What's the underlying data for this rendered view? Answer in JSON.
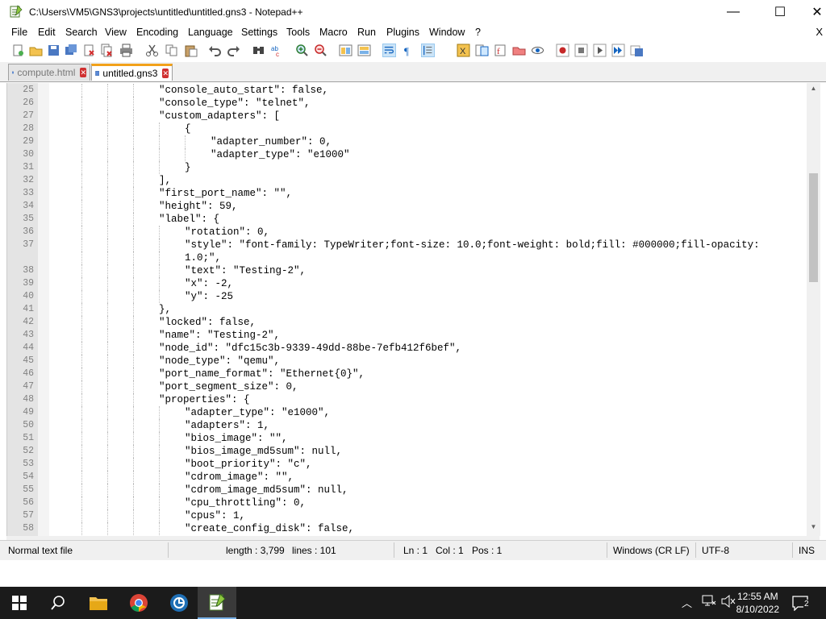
{
  "window": {
    "title": "C:\\Users\\VM5\\GNS3\\projects\\untitled\\untitled.gns3 - Notepad++",
    "minimize": "—",
    "maximize": "☐",
    "close": "✕"
  },
  "menu": {
    "items": [
      "File",
      "Edit",
      "Search",
      "View",
      "Encoding",
      "Language",
      "Settings",
      "Tools",
      "Macro",
      "Run",
      "Plugins",
      "Window",
      "?"
    ],
    "close_x": "X"
  },
  "tabs": [
    {
      "label": "compute.html",
      "active": false
    },
    {
      "label": "untitled.gns3",
      "active": true
    }
  ],
  "editor": {
    "lines": [
      {
        "n": "25",
        "indent": 4,
        "text": "\"console_auto_start\": false,"
      },
      {
        "n": "26",
        "indent": 4,
        "text": "\"console_type\": \"telnet\","
      },
      {
        "n": "27",
        "indent": 4,
        "text": "\"custom_adapters\": ["
      },
      {
        "n": "28",
        "indent": 5,
        "text": "{"
      },
      {
        "n": "29",
        "indent": 6,
        "text": "\"adapter_number\": 0,"
      },
      {
        "n": "30",
        "indent": 6,
        "text": "\"adapter_type\": \"e1000\""
      },
      {
        "n": "31",
        "indent": 5,
        "text": "}"
      },
      {
        "n": "32",
        "indent": 4,
        "text": "],"
      },
      {
        "n": "33",
        "indent": 4,
        "text": "\"first_port_name\": \"\","
      },
      {
        "n": "34",
        "indent": 4,
        "text": "\"height\": 59,"
      },
      {
        "n": "35",
        "indent": 4,
        "text": "\"label\": {"
      },
      {
        "n": "36",
        "indent": 5,
        "text": "\"rotation\": 0,"
      },
      {
        "n": "37",
        "indent": 5,
        "text": "\"style\": \"font-family: TypeWriter;font-size: 10.0;font-weight: bold;fill: #000000;fill-opacity:"
      },
      {
        "n": "",
        "indent": 5,
        "text": "1.0;\","
      },
      {
        "n": "38",
        "indent": 5,
        "text": "\"text\": \"Testing-2\","
      },
      {
        "n": "39",
        "indent": 5,
        "text": "\"x\": -2,"
      },
      {
        "n": "40",
        "indent": 5,
        "text": "\"y\": -25"
      },
      {
        "n": "41",
        "indent": 4,
        "text": "},"
      },
      {
        "n": "42",
        "indent": 4,
        "text": "\"locked\": false,"
      },
      {
        "n": "43",
        "indent": 4,
        "text": "\"name\": \"Testing-2\","
      },
      {
        "n": "44",
        "indent": 4,
        "text": "\"node_id\": \"dfc15c3b-9339-49dd-88be-7efb412f6bef\","
      },
      {
        "n": "45",
        "indent": 4,
        "text": "\"node_type\": \"qemu\","
      },
      {
        "n": "46",
        "indent": 4,
        "text": "\"port_name_format\": \"Ethernet{0}\","
      },
      {
        "n": "47",
        "indent": 4,
        "text": "\"port_segment_size\": 0,"
      },
      {
        "n": "48",
        "indent": 4,
        "text": "\"properties\": {"
      },
      {
        "n": "49",
        "indent": 5,
        "text": "\"adapter_type\": \"e1000\","
      },
      {
        "n": "50",
        "indent": 5,
        "text": "\"adapters\": 1,"
      },
      {
        "n": "51",
        "indent": 5,
        "text": "\"bios_image\": \"\","
      },
      {
        "n": "52",
        "indent": 5,
        "text": "\"bios_image_md5sum\": null,"
      },
      {
        "n": "53",
        "indent": 5,
        "text": "\"boot_priority\": \"c\","
      },
      {
        "n": "54",
        "indent": 5,
        "text": "\"cdrom_image\": \"\","
      },
      {
        "n": "55",
        "indent": 5,
        "text": "\"cdrom_image_md5sum\": null,"
      },
      {
        "n": "56",
        "indent": 5,
        "text": "\"cpu_throttling\": 0,"
      },
      {
        "n": "57",
        "indent": 5,
        "text": "\"cpus\": 1,"
      },
      {
        "n": "58",
        "indent": 5,
        "text": "\"create_config_disk\": false,"
      }
    ]
  },
  "status": {
    "file_type": "Normal text file",
    "length": "length : 3,799",
    "lines": "lines : 101",
    "ln": "Ln : 1",
    "col": "Col : 1",
    "pos": "Pos : 1",
    "eol": "Windows (CR LF)",
    "encoding": "UTF-8",
    "mode": "INS"
  },
  "taskbar": {
    "time": "12:55 AM",
    "date": "8/10/2022",
    "notifications": "2"
  },
  "colors": {
    "accent_tab": "#f2a11a",
    "taskbar": "#1b1b1b"
  }
}
